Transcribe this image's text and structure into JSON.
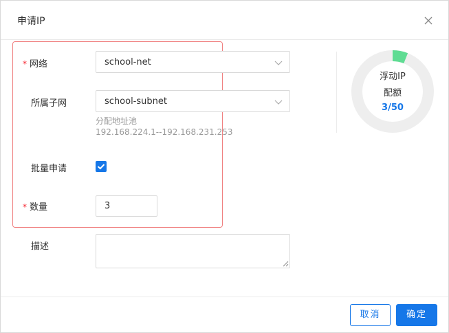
{
  "dialog": {
    "title": "申请IP",
    "close_icon": "close-icon"
  },
  "form": {
    "network": {
      "label": "网络",
      "required": "*",
      "value": "school-net"
    },
    "subnet": {
      "label": "所属子网",
      "value": "school-subnet",
      "pool_label": "分配地址池",
      "pool_range": "192.168.224.1--192.168.231.253"
    },
    "batch": {
      "label": "批量申请",
      "checked": true
    },
    "quantity": {
      "label": "数量",
      "required": "*",
      "value": "3"
    },
    "description": {
      "label": "描述",
      "value": ""
    }
  },
  "quota": {
    "line1": "浮动IP",
    "line2": "配额",
    "usage": "3/50",
    "used": 3,
    "total": 50,
    "used_color": "#5fdc93",
    "track_color": "#eeeeee"
  },
  "footer": {
    "cancel_label": "取消",
    "ok_label": "确定"
  },
  "colors": {
    "primary": "#1677e8",
    "required": "#f5222d",
    "highlight_border": "#f08080"
  }
}
